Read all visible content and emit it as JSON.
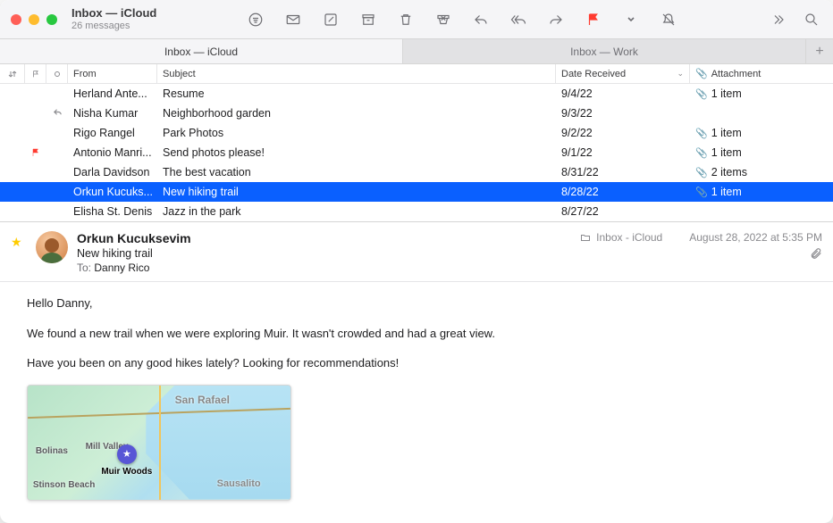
{
  "window": {
    "title": "Inbox — iCloud",
    "subtitle": "26 messages"
  },
  "tabs": [
    {
      "label": "Inbox — iCloud"
    },
    {
      "label": "Inbox — Work"
    }
  ],
  "columns": {
    "from": "From",
    "subject": "Subject",
    "date": "Date Received",
    "attachment": "Attachment"
  },
  "messages": [
    {
      "from": "Herland Ante...",
      "subject": "Resume",
      "date": "9/4/22",
      "attachment": "1 item",
      "flagged": false,
      "replied": false
    },
    {
      "from": "Nisha Kumar",
      "subject": "Neighborhood garden",
      "date": "9/3/22",
      "attachment": "",
      "flagged": false,
      "replied": true
    },
    {
      "from": "Rigo Rangel",
      "subject": "Park Photos",
      "date": "9/2/22",
      "attachment": "1 item",
      "flagged": false,
      "replied": false
    },
    {
      "from": "Antonio Manri...",
      "subject": "Send photos please!",
      "date": "9/1/22",
      "attachment": "1 item",
      "flagged": true,
      "replied": false
    },
    {
      "from": "Darla Davidson",
      "subject": "The best vacation",
      "date": "8/31/22",
      "attachment": "2 items",
      "flagged": false,
      "replied": false
    },
    {
      "from": "Orkun Kucuks...",
      "subject": "New hiking trail",
      "date": "8/28/22",
      "attachment": "1 item",
      "flagged": false,
      "replied": false,
      "selected": true
    },
    {
      "from": "Elisha St. Denis",
      "subject": "Jazz in the park",
      "date": "8/27/22",
      "attachment": "",
      "flagged": false,
      "replied": false
    }
  ],
  "detail": {
    "from": "Orkun Kucuksevim",
    "subject": "New hiking trail",
    "to_label": "To:",
    "to_recipient": "Danny Rico",
    "folder": "Inbox - iCloud",
    "datetime": "August 28, 2022 at 5:35 PM",
    "body": {
      "p1": "Hello Danny,",
      "p2": "We found a new trail when we were exploring Muir. It wasn't crowded and had a great view.",
      "p3": "Have you been on any good hikes lately? Looking for recommendations!"
    },
    "map_labels": {
      "muir_woods": "Muir Woods",
      "san_rafael": "San Rafael",
      "sausalito": "Sausalito",
      "bolinas": "Bolinas",
      "stinson": "Stinson Beach",
      "mill_valley": "Mill Valley"
    }
  }
}
